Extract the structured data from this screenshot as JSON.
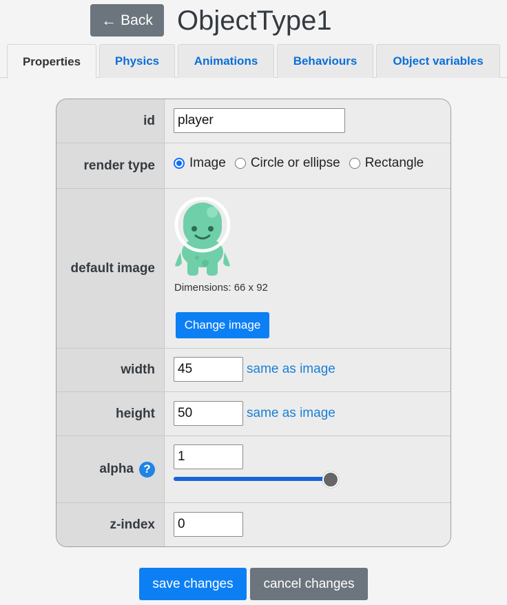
{
  "header": {
    "back_label": "Back",
    "title": "ObjectType1"
  },
  "tabs": [
    {
      "label": "Properties",
      "active": true
    },
    {
      "label": "Physics",
      "active": false
    },
    {
      "label": "Animations",
      "active": false
    },
    {
      "label": "Behaviours",
      "active": false
    },
    {
      "label": "Object variables",
      "active": false
    }
  ],
  "form": {
    "id": {
      "label": "id",
      "value": "player"
    },
    "render_type": {
      "label": "render type",
      "options": [
        "Image",
        "Circle or ellipse",
        "Rectangle"
      ],
      "selected": "Image"
    },
    "default_image": {
      "label": "default image",
      "image_icon": "alien-character-icon",
      "dimensions": "Dimensions: 66 x 92",
      "change_label": "Change image"
    },
    "width": {
      "label": "width",
      "value": "45",
      "link": "same as image"
    },
    "height": {
      "label": "height",
      "value": "50",
      "link": "same as image"
    },
    "alpha": {
      "label": "alpha",
      "value": "1",
      "help_icon": "question-icon",
      "slider_level": 1
    },
    "z_index": {
      "label": "z-index",
      "value": "0"
    }
  },
  "footer": {
    "save_label": "save changes",
    "cancel_label": "cancel changes"
  },
  "colors": {
    "accent": "#0d7ff5",
    "secondary": "#6c757d",
    "character": "#6fcfa9"
  }
}
